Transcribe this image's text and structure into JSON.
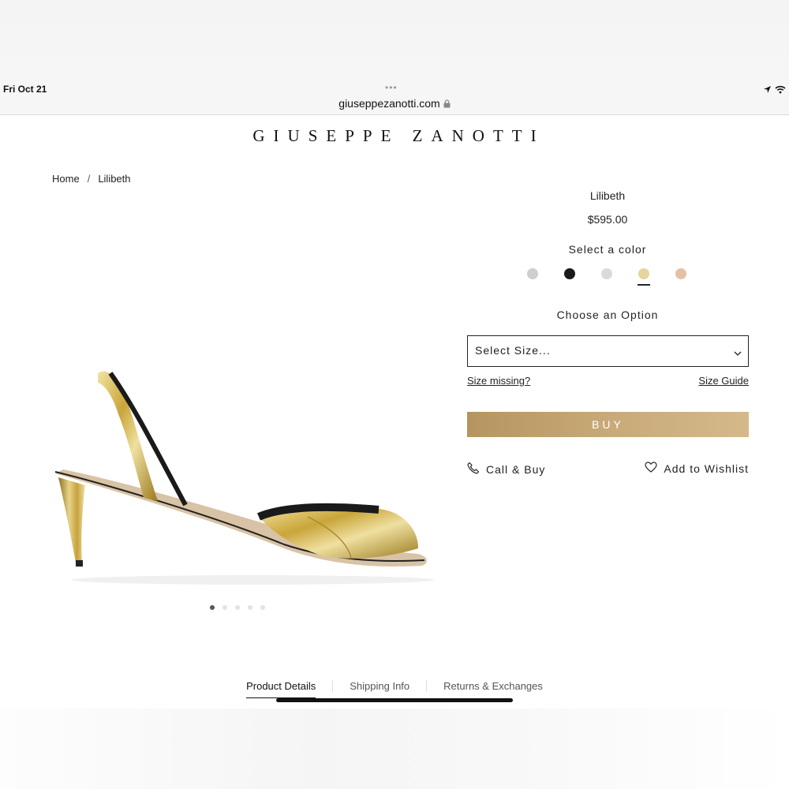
{
  "status_bar": {
    "date": "Fri Oct 21",
    "url": "giuseppezanotti.com",
    "dots": "•••"
  },
  "brand": "GIUSEPPE ZANOTTI",
  "breadcrumb": {
    "home": "Home",
    "separator": "/",
    "current": "Lilibeth"
  },
  "product": {
    "name": "Lilibeth",
    "price": "$595.00",
    "select_color_label": "Select a color",
    "colors": [
      "#cfcfcf",
      "#1a1a1a",
      "#dadada",
      "#e7d49e",
      "#e3c2a2"
    ],
    "selected_color_index": 3,
    "choose_option_label": "Choose an Option",
    "size_placeholder": "Select Size...",
    "size_missing": "Size missing?",
    "size_guide": "Size Guide",
    "buy_label": "BUY",
    "call_buy": "Call & Buy",
    "add_wishlist": "Add to Wishlist"
  },
  "carousel": {
    "total": 5,
    "active": 1
  },
  "tabs": [
    "Product Details",
    "Shipping Info",
    "Returns & Exchanges"
  ],
  "active_tab": "Product Details",
  "accent_color": "#c8aa78"
}
